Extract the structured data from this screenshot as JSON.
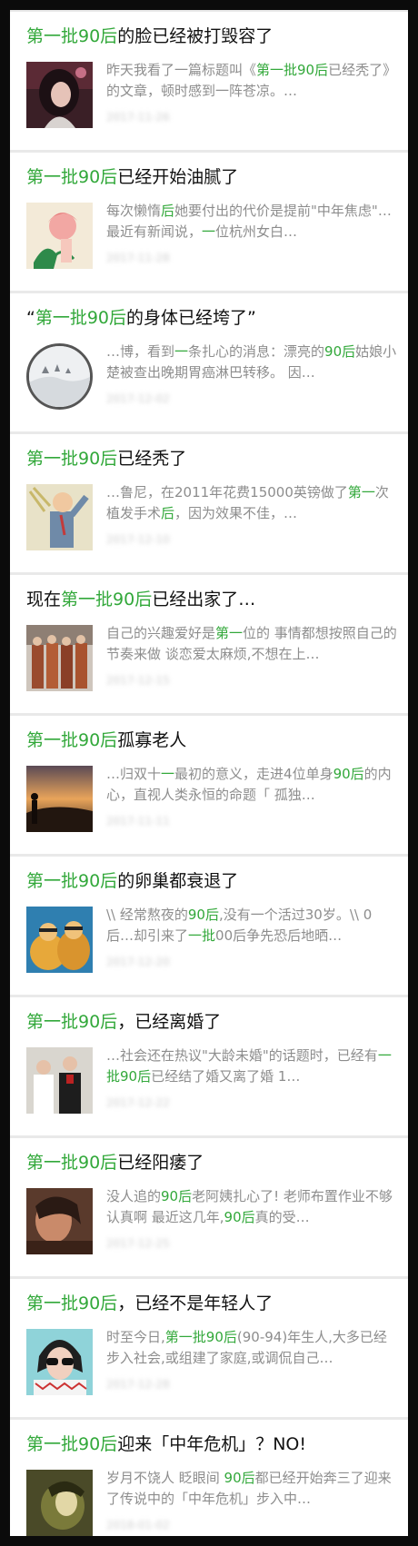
{
  "articles": [
    {
      "title_pre": "",
      "title_hl": "第一批90后",
      "title_post": "的脸已经被打毁容了",
      "summary": [
        {
          "t": "昨天我看了一篇标题叫《",
          "h": false
        },
        {
          "t": "第一批90后",
          "h": true
        },
        {
          "t": "已经秃了》的文章，顿时感到一阵苍凉。…",
          "h": false
        }
      ],
      "meta": "2017-11-26",
      "thumb_icon": "girl-portrait-icon"
    },
    {
      "title_pre": "",
      "title_hl": "第一批90后",
      "title_post": "已经开始油腻了",
      "summary": [
        {
          "t": "每次懒惰",
          "h": false
        },
        {
          "t": "后",
          "h": true
        },
        {
          "t": "她要付出的代价是提前\"中年焦虑\"…最近有新闻说，",
          "h": false
        },
        {
          "t": "一",
          "h": true
        },
        {
          "t": "位杭州女白…",
          "h": false
        }
      ],
      "meta": "2017-11-28",
      "thumb_icon": "illustrated-woman-icon"
    },
    {
      "title_pre": "“",
      "title_hl": "第一批90后",
      "title_post": "的身体已经垮了”",
      "summary": [
        {
          "t": "…博，看到",
          "h": false
        },
        {
          "t": "一",
          "h": true
        },
        {
          "t": "条扎心的消息：漂亮的",
          "h": false
        },
        {
          "t": "90后",
          "h": true
        },
        {
          "t": "姑娘小楚被查出晚期胃癌淋巴转移。 因…",
          "h": false
        }
      ],
      "meta": "2017-12-02",
      "thumb_icon": "snow-landscape-icon"
    },
    {
      "title_pre": "",
      "title_hl": "第一批90后",
      "title_post": "已经秃了",
      "summary": [
        {
          "t": "…鲁尼，在2011年花费15000英镑做了",
          "h": false
        },
        {
          "t": "第一",
          "h": true
        },
        {
          "t": "次植发手术",
          "h": false
        },
        {
          "t": "后",
          "h": true
        },
        {
          "t": "，因为效果不佳，…",
          "h": false
        }
      ],
      "meta": "2017-12-10",
      "thumb_icon": "cartoon-man-icon"
    },
    {
      "title_pre": "现在",
      "title_hl": "第一批90后",
      "title_post": "已经出家了…",
      "summary": [
        {
          "t": "自己的兴趣爱好是",
          "h": false
        },
        {
          "t": "第一",
          "h": true
        },
        {
          "t": "位的 事情都想按照自己的节奏来做 谈恋爱太麻烦,不想在上…",
          "h": false
        }
      ],
      "meta": "2017-12-15",
      "thumb_icon": "monks-group-icon"
    },
    {
      "title_pre": "",
      "title_hl": "第一批90后",
      "title_post": "孤寡老人",
      "summary": [
        {
          "t": "…归双十",
          "h": false
        },
        {
          "t": "一",
          "h": true
        },
        {
          "t": "最初的意义，走进4位单身",
          "h": false
        },
        {
          "t": "90后",
          "h": true
        },
        {
          "t": "的内心，直视人类永恒的命题「 孤独…",
          "h": false
        }
      ],
      "meta": "2017-11-11",
      "thumb_icon": "sunset-silhouette-icon"
    },
    {
      "title_pre": "",
      "title_hl": "第一批90后",
      "title_post": "的卵巢都衰退了",
      "summary": [
        {
          "t": "\\\\ 经常熬夜的",
          "h": false
        },
        {
          "t": "90后",
          "h": true
        },
        {
          "t": ",没有一个活过30岁。\\\\ 0后…却引来了",
          "h": false
        },
        {
          "t": "一批",
          "h": true
        },
        {
          "t": "00后争先恐后地晒…",
          "h": false
        }
      ],
      "meta": "2017-12-20",
      "thumb_icon": "cartoon-couple-icon"
    },
    {
      "title_pre": "",
      "title_hl": "第一批90后",
      "title_post": "，已经离婚了",
      "summary": [
        {
          "t": "…社会还在热议\"大龄未婚\"的话题时，已经有",
          "h": false
        },
        {
          "t": "一批90后",
          "h": true
        },
        {
          "t": "已经结了婚又离了婚 1…",
          "h": false
        }
      ],
      "meta": "2017-12-22",
      "thumb_icon": "wedding-couple-icon"
    },
    {
      "title_pre": "",
      "title_hl": "第一批90后",
      "title_post": "已经阳痿了",
      "summary": [
        {
          "t": "没人追的",
          "h": false
        },
        {
          "t": "90后",
          "h": true
        },
        {
          "t": "老阿姨扎心了! 老师布置作业不够认真啊 最近这几年,",
          "h": false
        },
        {
          "t": "90后",
          "h": true
        },
        {
          "t": "真的受…",
          "h": false
        }
      ],
      "meta": "2017-12-25",
      "thumb_icon": "dim-portrait-icon"
    },
    {
      "title_pre": "",
      "title_hl": "第一批90后",
      "title_post": "，已经不是年轻人了",
      "summary": [
        {
          "t": "时至今日,",
          "h": false
        },
        {
          "t": "第一批90后",
          "h": true
        },
        {
          "t": "(90-94)年生人,大多已经步入社会,或组建了家庭,或调侃自己…",
          "h": false
        }
      ],
      "meta": "2017-12-28",
      "thumb_icon": "sunglasses-woman-icon"
    },
    {
      "title_pre": "",
      "title_hl": "第一批90后",
      "title_post": "迎来「中年危机」？NO!",
      "summary": [
        {
          "t": "岁月不饶人 眨眼间 ",
          "h": false
        },
        {
          "t": "90后",
          "h": true
        },
        {
          "t": "都已经开始奔三了迎来了传说中的「中年危机」步入中…",
          "h": false
        }
      ],
      "meta": "2018-01-02",
      "thumb_icon": "film-still-icon"
    }
  ],
  "colors": {
    "highlight": "#32a83a",
    "summary": "#8d8d8d",
    "title": "#111111"
  }
}
